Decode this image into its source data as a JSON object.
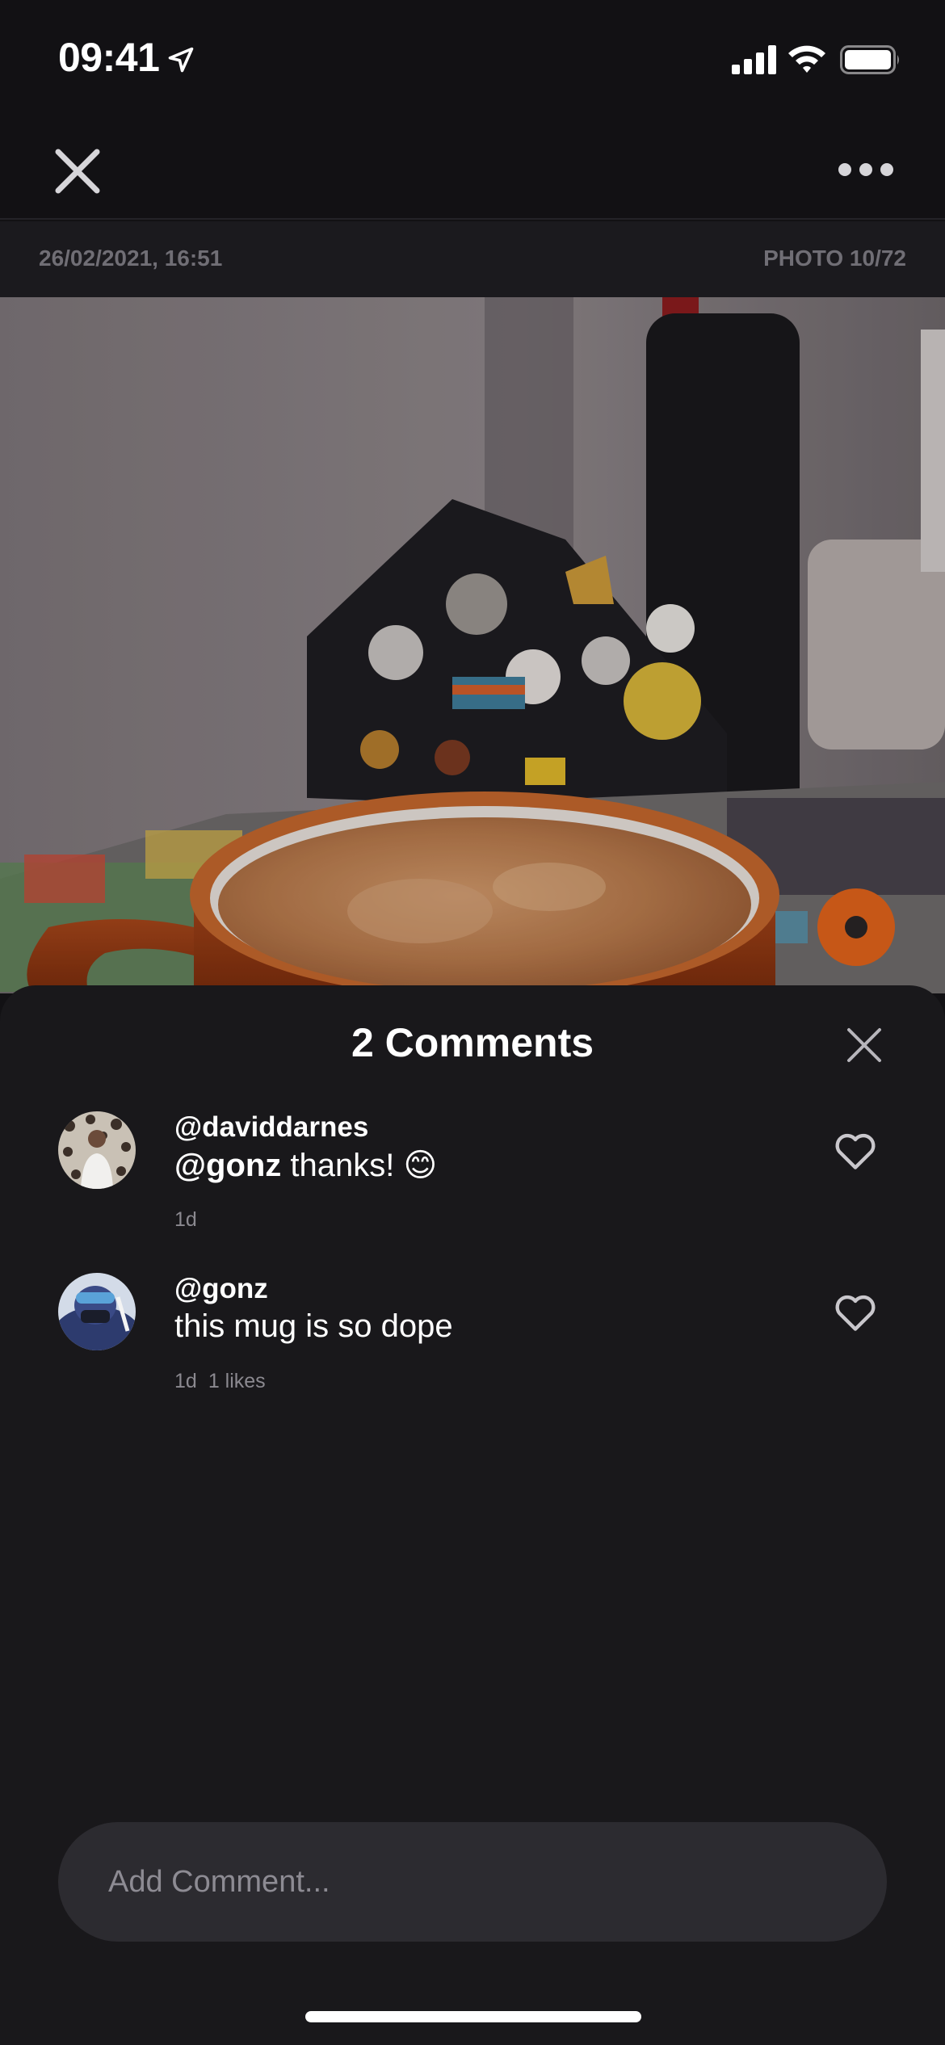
{
  "status_bar": {
    "time": "09:41"
  },
  "meta": {
    "date": "26/02/2021, 16:51",
    "photo_counter": "PHOTO 10/72"
  },
  "sheet": {
    "title": "2 Comments",
    "comments": [
      {
        "user": "@daviddarnes",
        "mention": "@gonz",
        "text": " thanks! 😊",
        "age": "1d",
        "likes": ""
      },
      {
        "user": "@gonz",
        "mention": "",
        "text": "this mug is so dope",
        "age": "1d",
        "likes": "1 likes"
      }
    ]
  },
  "composer": {
    "placeholder": "Add Comment..."
  },
  "icons": [
    "location-arrow-icon",
    "signal-icon",
    "wifi-icon",
    "battery-icon",
    "close-icon",
    "more-icon",
    "heart-icon"
  ]
}
